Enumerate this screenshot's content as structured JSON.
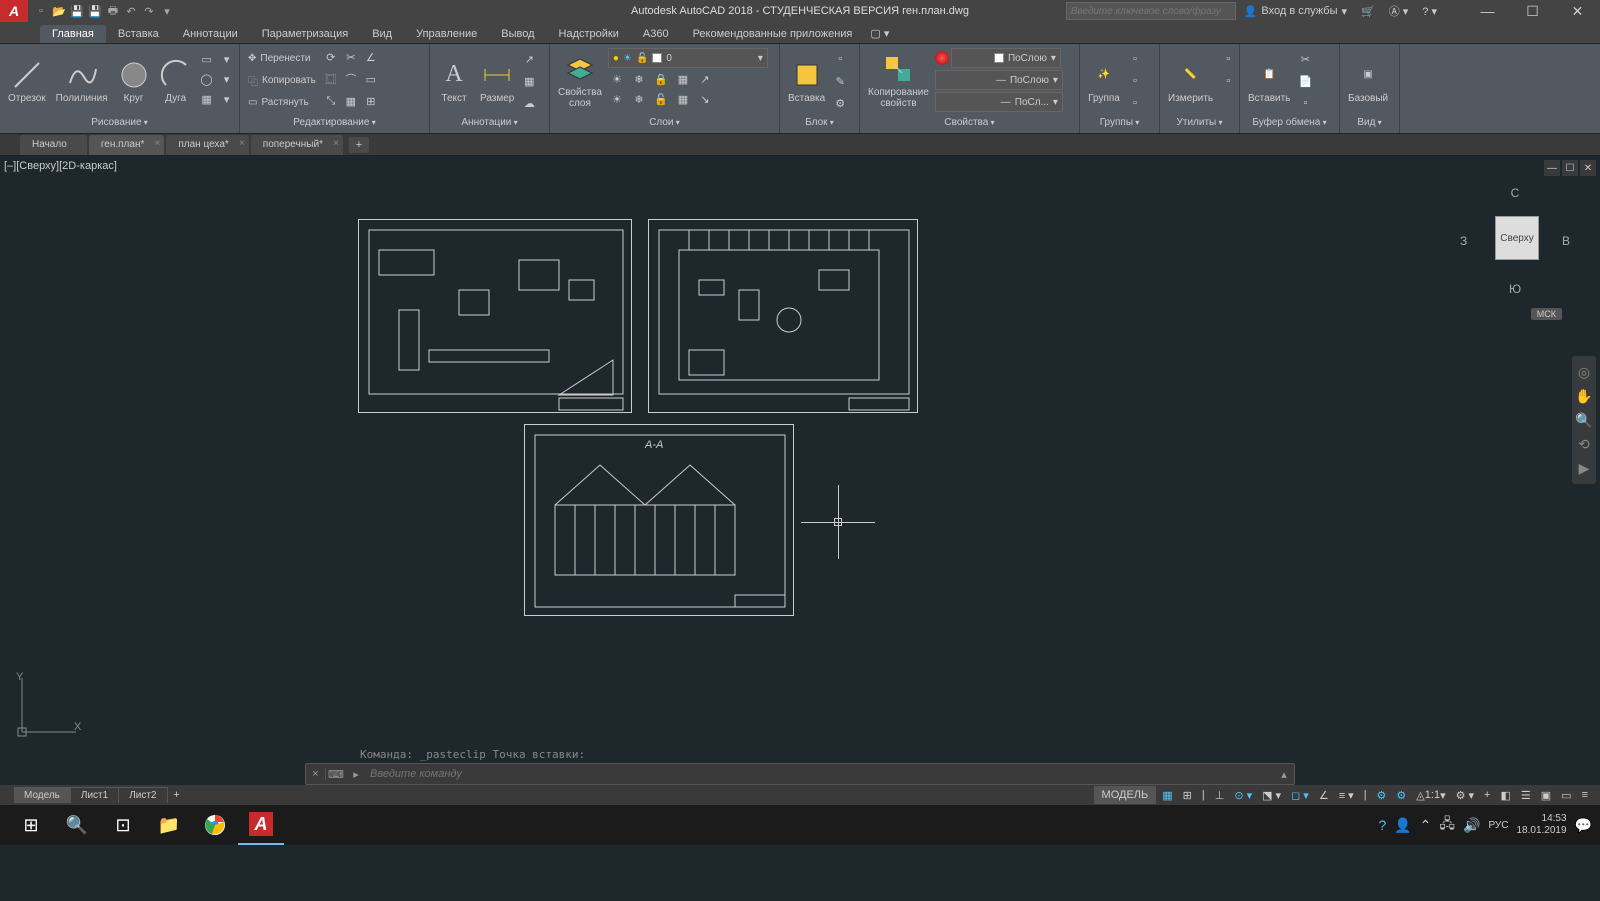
{
  "title": "Autodesk AutoCAD 2018 - СТУДЕНЧЕСКАЯ ВЕРСИЯ   ген.план.dwg",
  "search_placeholder": "Введите ключевое слово/фразу",
  "signin": "Вход в службы",
  "ribbon_tabs": [
    "Главная",
    "Вставка",
    "Аннотации",
    "Параметризация",
    "Вид",
    "Управление",
    "Вывод",
    "Надстройки",
    "A360",
    "Рекомендованные приложения"
  ],
  "active_ribbon_tab": 0,
  "panels": {
    "draw": {
      "label": "Рисование",
      "line": "Отрезок",
      "polyline": "Полилиния",
      "circle": "Круг",
      "arc": "Дуга"
    },
    "modify": {
      "label": "Редактирование",
      "move": "Перенести",
      "copy": "Копировать",
      "stretch": "Растянуть"
    },
    "annotation": {
      "label": "Аннотации",
      "text": "Текст",
      "dim": "Размер"
    },
    "layers": {
      "label": "Слои",
      "props": "Свойства\nслоя",
      "current": "0"
    },
    "block": {
      "label": "Блок",
      "insert": "Вставка"
    },
    "properties": {
      "label": "Свойства",
      "match": "Копирование\nсвойств",
      "bylayer": "ПоСлою",
      "bylayer2": "ПоСлою",
      "bylayer3": "ПоСл..."
    },
    "groups": {
      "label": "Группы",
      "group": "Группа"
    },
    "utilities": {
      "label": "Утилиты",
      "measure": "Измерить"
    },
    "clipboard": {
      "label": "Буфер обмена",
      "paste": "Вставить"
    },
    "view": {
      "label": "Вид",
      "base": "Базовый"
    }
  },
  "file_tabs": [
    "Начало",
    "ген.план*",
    "план цеха*",
    "поперечный*"
  ],
  "active_file_tab": 1,
  "viewport_label": "[–][Сверху][2D-каркас]",
  "viewcube": {
    "face": "Сверху",
    "n": "С",
    "s": "Ю",
    "e": "В",
    "w": "З",
    "wcs": "МСК"
  },
  "section_label": "А-А",
  "cmd_history": "Команда: _pasteclip Точка вставки:",
  "cmd_placeholder": "Введите команду",
  "layout_tabs": [
    "Модель",
    "Лист1",
    "Лист2"
  ],
  "active_layout": 0,
  "status": {
    "model": "МОДЕЛЬ",
    "scale": "1:1"
  },
  "taskbar": {
    "lang": "РУС",
    "time": "14:53",
    "date": "18.01.2019"
  }
}
